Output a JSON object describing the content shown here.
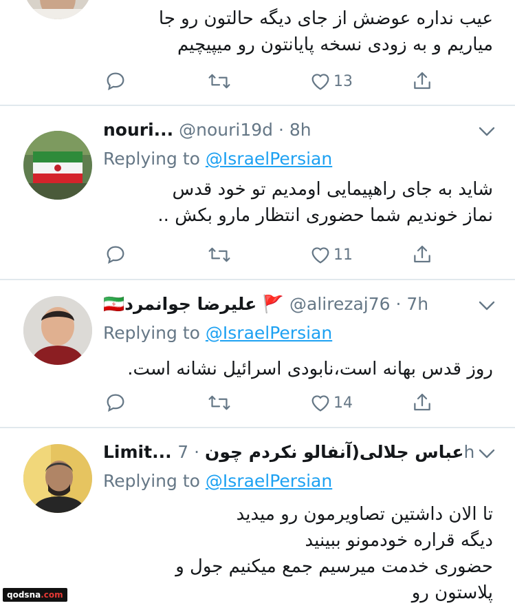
{
  "tweet0": {
    "text": "عیب نداره عوضش از جای دیگه حالتون رو جا\nمیاریم و به زودی نسخه پایانتون رو میپیچیم",
    "likes": "13"
  },
  "tweet1": {
    "name": "nouri...",
    "handle": "@nouri19d",
    "dot": "·",
    "time": "8h",
    "replying_label": "Replying to",
    "replying_to": "@IsraelPersian",
    "text": "شاید به جای راهپیمایی اومدیم تو خود قدس\nنماز خوندیم شما حضوری انتظار مارو بکش ..",
    "likes": "11"
  },
  "tweet2": {
    "name": "🇮🇷علیرضا جوانمرد 🚩",
    "handle": "@alirezaj76",
    "dot": "·",
    "time": "7h",
    "replying_label": "Replying to",
    "replying_to": "@IsraelPersian",
    "text": "روز قدس بهانه است،نابودی اسرائیل نشانه است.",
    "likes": "14"
  },
  "tweet3": {
    "name": "Limit... عباس جلالی(آنفالو نکردم چون",
    "dot": "·",
    "time": "7h",
    "replying_label": "Replying to",
    "replying_to": "@IsraelPersian",
    "text": "تا الان داشتین تصاویرمون رو میدید\nدیگه قراره خودمونو ببینید\nحضوری خدمت میرسیم جمع میکنیم جول و\nپلاستون رو"
  },
  "icons": {
    "reply": "reply-bubble-icon",
    "retweet": "retweet-icon",
    "like": "heart-icon",
    "share": "share-icon",
    "more": "chevron-down-icon"
  },
  "colors": {
    "link": "#1da1f2",
    "muted": "#657786",
    "divider": "#e1e8ed"
  },
  "watermark": {
    "prefix": "qodsna",
    "suffix": ".com"
  }
}
